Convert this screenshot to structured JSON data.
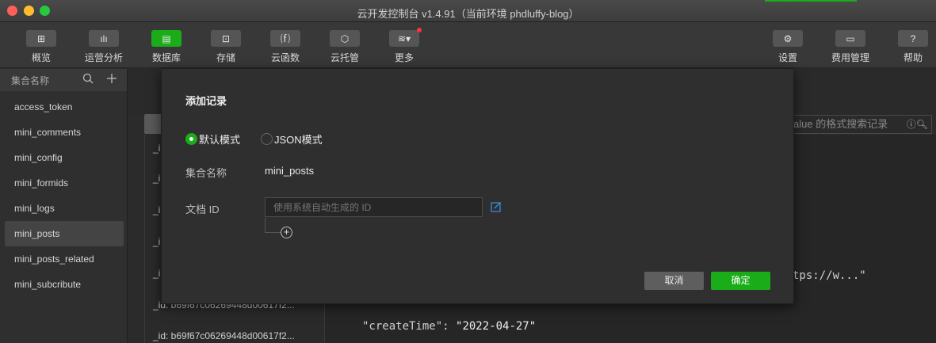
{
  "window": {
    "title": "云开发控制台 v1.4.91（当前环境 phdluffy-blog）"
  },
  "toolbar": {
    "left": [
      {
        "label": "概览",
        "icon": "⊞"
      },
      {
        "label": "运营分析",
        "icon": "ılı"
      },
      {
        "label": "数据库",
        "icon": "▤"
      },
      {
        "label": "存储",
        "icon": "⊡"
      },
      {
        "label": "云函数",
        "icon": "⒡"
      },
      {
        "label": "云托管",
        "icon": "⬡"
      },
      {
        "label": "更多",
        "icon": "≋▾"
      }
    ],
    "right": [
      {
        "label": "设置",
        "icon": "⚙"
      },
      {
        "label": "费用管理",
        "icon": "▭"
      },
      {
        "label": "帮助",
        "icon": "?"
      }
    ]
  },
  "sidebar": {
    "header": "集合名称",
    "items": [
      "access_token",
      "mini_comments",
      "mini_config",
      "mini_formids",
      "mini_logs",
      "mini_posts",
      "mini_posts_related",
      "mini_subcribute"
    ],
    "selected": "mini_posts"
  },
  "background": {
    "search_placeholder": "alue 的格式搜索记录",
    "list_rows": [
      "_i",
      "_i",
      "_i",
      "_i",
      "_i",
      "_id: b69f67c06269448d00617f2...",
      "_id: b69f67c06269448d00617f2..."
    ],
    "json_fragment": "tps://w...\"",
    "create_time_key": "\"createTime\"",
    "create_time_value": "\"2022-04-27\""
  },
  "modal": {
    "title": "添加记录",
    "mode_default": "默认模式",
    "mode_json": "JSON模式",
    "collection_label": "集合名称",
    "collection_value": "mini_posts",
    "doc_id_label": "文档 ID",
    "doc_id_placeholder": "使用系统自动生成的 ID",
    "cancel": "取消",
    "confirm": "确定"
  },
  "colors": {
    "accent": "#1aad19",
    "link": "#3a8ee6"
  }
}
